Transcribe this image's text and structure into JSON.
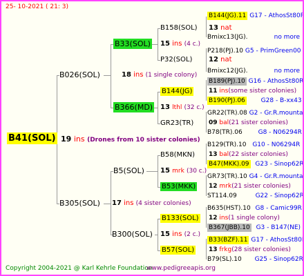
{
  "header": {
    "date": "25- 10-2021 ( 21: 3)"
  },
  "footer": {
    "copyright": "Copyright 2004-2021 @ Karl Kehrle Foundation",
    "site": "www.pedigreeapis.org"
  },
  "root": {
    "name": "B41(SOL)",
    "count": "19",
    "ins": "ins",
    "note": "(Drones from 10 sister colonies)"
  },
  "gen1": {
    "top": {
      "name": "B026(SOL)",
      "count": "18",
      "ins": "ins",
      "note": "(1 single colony)"
    },
    "bottom": {
      "name": "B305(SOL)",
      "count": "17",
      "ins": "ins",
      "note": "(4 sister colonies)"
    }
  },
  "gen2": {
    "a": {
      "name": "B33(SOL)",
      "count": "15",
      "ins": "ins",
      "note": "(4 c.)"
    },
    "b": {
      "name": "B366(MD)",
      "count": "13",
      "ins": "lthl",
      "note": "(32 c.)"
    },
    "c": {
      "name": "B5(SOL)",
      "count": "15",
      "ins": "mrk",
      "note": "(30 c.)"
    },
    "d": {
      "name": "B300(SOL)",
      "count": "15",
      "ins": "ins",
      "note": "(2 c.)"
    }
  },
  "gen3": {
    "a1": {
      "name": "B158(SOL)",
      "count": "13",
      "ins": "nat"
    },
    "a2": {
      "name": "P32(SOL)",
      "count": "12",
      "ins": "nat"
    },
    "b1": {
      "name": "B144(JG)",
      "count": "11",
      "ins": "ins",
      "note": "(some sister colonies)"
    },
    "b2": {
      "name": "GR23(TR)",
      "count": "09",
      "ins": "bal",
      "note": "(21 sister colonies)"
    },
    "c1": {
      "name": "B58(MKN)",
      "count": "13",
      "ins": "bal",
      "note": "(22 sister colonies)"
    },
    "c2": {
      "name": "B53(MKK)",
      "count": "12",
      "ins": "mrk",
      "note": "(21 sister colonies)"
    },
    "d1": {
      "name": "B133(SOL)",
      "count": "12",
      "ins": "ins",
      "note": "(1 single colony)"
    },
    "d2": {
      "name": "B57(SOL)",
      "count": "13",
      "ins": "frkg",
      "note": "(28 sister colonies)"
    }
  },
  "gen4": [
    {
      "name": "B144(JG).11",
      "info": "G17 - AthosSt80R"
    },
    {
      "name": "Bmixc13(JG).",
      "info": "no more"
    },
    {
      "name": "P218(PJ).10",
      "info": "G5 - PrimGreen00"
    },
    {
      "name": "Bmixc12(JG).",
      "info": "no more"
    },
    {
      "name": "B189(PJ).10",
      "info": "G16 - AthosSt80R"
    },
    {
      "name": "B190(PJ).06",
      "info": "G28 - B-xx43"
    },
    {
      "name": "GR22(TR).08",
      "info": "G2 - Gr.R.mounta"
    },
    {
      "name": "B78(TR).06",
      "info": "G8 - N06294R"
    },
    {
      "name": "B129(TR).10",
      "info": "G10 - N06294R"
    },
    {
      "name": "B47(MKK).09",
      "info": "G23 - Sinop62R"
    },
    {
      "name": "GR73(TR).10",
      "info": "G4 - Gr.R.mounta"
    },
    {
      "name": "ST114.09",
      "info": "G22 - Sinop62R"
    },
    {
      "name": "B635(HST).10",
      "info": "G8 - Camic99R"
    },
    {
      "name": "B367(JBB).10",
      "info": "G3 - B147(NE)"
    },
    {
      "name": "B33(BZF).11",
      "info": "G17 - AthosSt80R"
    },
    {
      "name": "B79(SL).10",
      "info": "G25 - Sinop62R"
    }
  ],
  "colors": {
    "border": "#ff44ff",
    "highlight_yellow": "#ffff00",
    "highlight_green": "#22dd22",
    "highlight_gray": "#b8b8b8",
    "ins_red": "#ff0000",
    "note_purple": "#800080",
    "gen4_info_blue": "#0000ee"
  }
}
